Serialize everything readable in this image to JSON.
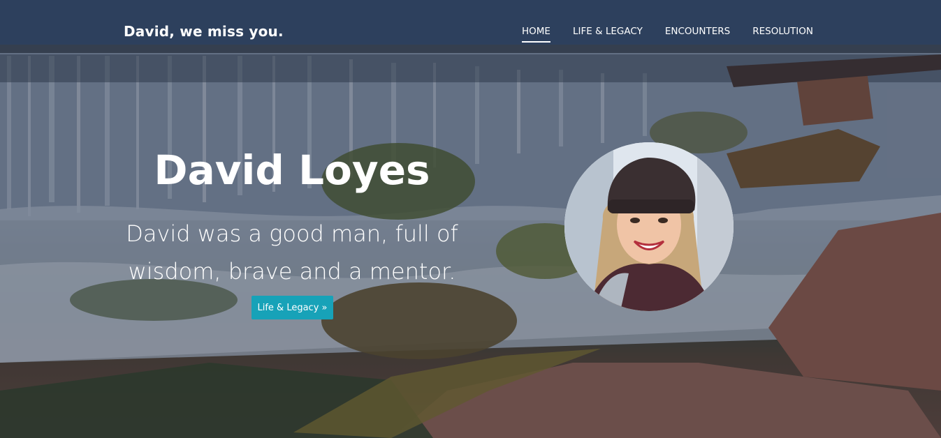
{
  "navbar": {
    "brand": "David, we miss you.",
    "items": [
      {
        "label": "HOME",
        "active": true
      },
      {
        "label": "LIFE & LEGACY",
        "active": false
      },
      {
        "label": "ENCOUNTERS",
        "active": false
      },
      {
        "label": "RESOLUTION",
        "active": false
      }
    ]
  },
  "hero": {
    "title": "David Loyes",
    "subtitle": "David was a good man, full of wisdom, brave and a mentor.",
    "button_label": "Life & Legacy »",
    "button_color": "#17a2b8",
    "background": "waterfall-photo",
    "portrait": "profile-photo"
  }
}
